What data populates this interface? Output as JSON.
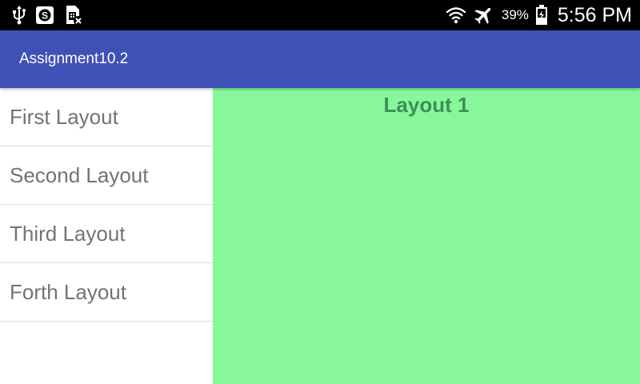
{
  "status_bar": {
    "battery_percent": "39%",
    "time": "5:56 PM",
    "icons": [
      "usb-icon",
      "app-s-icon",
      "no-sim-icon",
      "wifi-icon",
      "airplane-mode-icon",
      "battery-icon"
    ]
  },
  "app_bar": {
    "title": "Assignment10.2",
    "color": "#3f51b5"
  },
  "list": {
    "items": [
      {
        "label": "First Layout"
      },
      {
        "label": "Second Layout"
      },
      {
        "label": "Third Layout"
      },
      {
        "label": "Forth Layout"
      }
    ]
  },
  "content": {
    "title": "Layout 1",
    "background": "#88f79c"
  }
}
